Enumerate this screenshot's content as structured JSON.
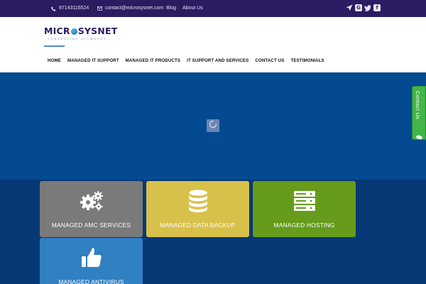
{
  "topbar": {
    "phone": "97143116524",
    "email": "contact@microsysnet.com",
    "links": [
      "Blog",
      "About Us"
    ],
    "social_icons": [
      "location-arrow-icon",
      "google-plus-icon",
      "twitter-icon",
      "facebook-icon"
    ]
  },
  "logo": {
    "text_left": "MICR",
    "text_right": "SYSNET",
    "tagline": "CONNECTING NETWORKS"
  },
  "nav": {
    "items": [
      "HOME",
      "MANAGED IT SUPPORT",
      "MANAGED IT PRODUCTS",
      "IT SUPPORT AND SERVICES",
      "CONTACT US",
      "TESTIMONIALS"
    ]
  },
  "services": [
    {
      "label": "MANAGED AMC SERVICES",
      "icon": "gears-icon",
      "color": "#7a7a7a"
    },
    {
      "label": "MANAGED DATA BACKUP",
      "icon": "database-icon",
      "color": "#d8c14a"
    },
    {
      "label": "MANAGED HOSTING",
      "icon": "server-icon",
      "color": "#669b1b"
    },
    {
      "label": "MANAGED ANTIVIRUS",
      "icon": "thumbs-up-icon",
      "color": "#3180c1"
    }
  ],
  "contact_tab": {
    "label": "Contact Us"
  },
  "colors": {
    "topbar": "#2b1b61",
    "hero": "#034a91",
    "lower": "#063876",
    "contact_tab": "#43b649"
  }
}
